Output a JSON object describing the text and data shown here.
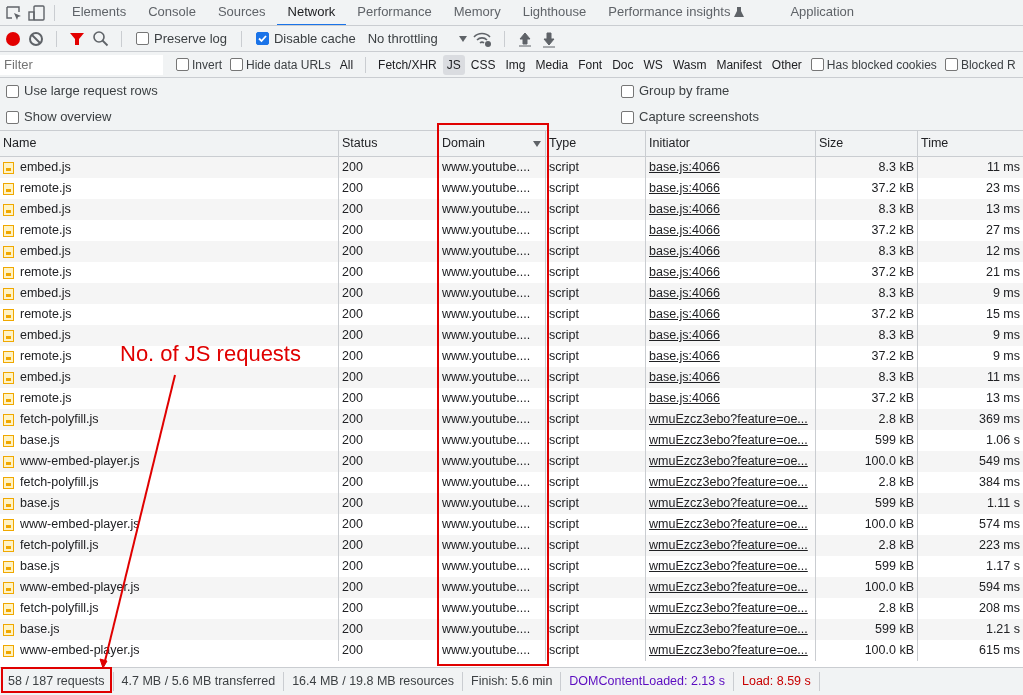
{
  "tabs": [
    {
      "label": "Elements",
      "selected": false,
      "experimental": false
    },
    {
      "label": "Console",
      "selected": false,
      "experimental": false
    },
    {
      "label": "Sources",
      "selected": false,
      "experimental": false
    },
    {
      "label": "Network",
      "selected": true,
      "experimental": false
    },
    {
      "label": "Performance",
      "selected": false,
      "experimental": false
    },
    {
      "label": "Memory",
      "selected": false,
      "experimental": false
    },
    {
      "label": "Lighthouse",
      "selected": false,
      "experimental": false
    },
    {
      "label": "Performance insights",
      "selected": false,
      "experimental": true
    },
    {
      "label": "Application",
      "selected": false,
      "experimental": false
    }
  ],
  "toolbar": {
    "recording": true,
    "filter_active": true,
    "preserve_log": {
      "label": "Preserve log",
      "checked": false
    },
    "disable_cache": {
      "label": "Disable cache",
      "checked": true
    },
    "throttling": {
      "value": "No throttling"
    }
  },
  "filter_bar": {
    "placeholder": "Filter",
    "checkboxes": [
      {
        "label": "Invert",
        "checked": false
      },
      {
        "label": "Hide data URLs",
        "checked": false
      }
    ],
    "types": [
      {
        "label": "All",
        "selected": false
      },
      {
        "label": "Fetch/XHR",
        "selected": false
      },
      {
        "label": "JS",
        "selected": true
      },
      {
        "label": "CSS",
        "selected": false
      },
      {
        "label": "Img",
        "selected": false
      },
      {
        "label": "Media",
        "selected": false
      },
      {
        "label": "Font",
        "selected": false
      },
      {
        "label": "Doc",
        "selected": false
      },
      {
        "label": "WS",
        "selected": false
      },
      {
        "label": "Wasm",
        "selected": false
      },
      {
        "label": "Manifest",
        "selected": false
      },
      {
        "label": "Other",
        "selected": false
      }
    ],
    "extra_checkboxes": [
      {
        "label": "Has blocked cookies",
        "checked": false
      },
      {
        "label": "Blocked R",
        "checked": false
      }
    ]
  },
  "options": [
    {
      "label": "Use large request rows",
      "checked": false
    },
    {
      "label": "Group by frame",
      "checked": false
    },
    {
      "label": "Show overview",
      "checked": false
    },
    {
      "label": "Capture screenshots",
      "checked": false
    }
  ],
  "table": {
    "columns": [
      {
        "label": "Name",
        "sorted": false
      },
      {
        "label": "Status",
        "sorted": false
      },
      {
        "label": "Domain",
        "sorted": true
      },
      {
        "label": "Type",
        "sorted": false
      },
      {
        "label": "Initiator",
        "sorted": false
      },
      {
        "label": "Size",
        "sorted": false
      },
      {
        "label": "Time",
        "sorted": false
      }
    ],
    "rows": [
      [
        "embed.js",
        "200",
        "www.youtube....",
        "script",
        "base.js:4066",
        "8.3 kB",
        "11 ms"
      ],
      [
        "remote.js",
        "200",
        "www.youtube....",
        "script",
        "base.js:4066",
        "37.2 kB",
        "23 ms"
      ],
      [
        "embed.js",
        "200",
        "www.youtube....",
        "script",
        "base.js:4066",
        "8.3 kB",
        "13 ms"
      ],
      [
        "remote.js",
        "200",
        "www.youtube....",
        "script",
        "base.js:4066",
        "37.2 kB",
        "27 ms"
      ],
      [
        "embed.js",
        "200",
        "www.youtube....",
        "script",
        "base.js:4066",
        "8.3 kB",
        "12 ms"
      ],
      [
        "remote.js",
        "200",
        "www.youtube....",
        "script",
        "base.js:4066",
        "37.2 kB",
        "21 ms"
      ],
      [
        "embed.js",
        "200",
        "www.youtube....",
        "script",
        "base.js:4066",
        "8.3 kB",
        "9 ms"
      ],
      [
        "remote.js",
        "200",
        "www.youtube....",
        "script",
        "base.js:4066",
        "37.2 kB",
        "15 ms"
      ],
      [
        "embed.js",
        "200",
        "www.youtube....",
        "script",
        "base.js:4066",
        "8.3 kB",
        "9 ms"
      ],
      [
        "remote.js",
        "200",
        "www.youtube....",
        "script",
        "base.js:4066",
        "37.2 kB",
        "9 ms"
      ],
      [
        "embed.js",
        "200",
        "www.youtube....",
        "script",
        "base.js:4066",
        "8.3 kB",
        "11 ms"
      ],
      [
        "remote.js",
        "200",
        "www.youtube....",
        "script",
        "base.js:4066",
        "37.2 kB",
        "13 ms"
      ],
      [
        "fetch-polyfill.js",
        "200",
        "www.youtube....",
        "script",
        "wmuEzcz3ebo?feature=oe...",
        "2.8 kB",
        "369 ms"
      ],
      [
        "base.js",
        "200",
        "www.youtube....",
        "script",
        "wmuEzcz3ebo?feature=oe...",
        "599 kB",
        "1.06 s"
      ],
      [
        "www-embed-player.js",
        "200",
        "www.youtube....",
        "script",
        "wmuEzcz3ebo?feature=oe...",
        "100.0 kB",
        "549 ms"
      ],
      [
        "fetch-polyfill.js",
        "200",
        "www.youtube....",
        "script",
        "wmuEzcz3ebo?feature=oe...",
        "2.8 kB",
        "384 ms"
      ],
      [
        "base.js",
        "200",
        "www.youtube....",
        "script",
        "wmuEzcz3ebo?feature=oe...",
        "599 kB",
        "1.11 s"
      ],
      [
        "www-embed-player.js",
        "200",
        "www.youtube....",
        "script",
        "wmuEzcz3ebo?feature=oe...",
        "100.0 kB",
        "574 ms"
      ],
      [
        "fetch-polyfill.js",
        "200",
        "www.youtube....",
        "script",
        "wmuEzcz3ebo?feature=oe...",
        "2.8 kB",
        "223 ms"
      ],
      [
        "base.js",
        "200",
        "www.youtube....",
        "script",
        "wmuEzcz3ebo?feature=oe...",
        "599 kB",
        "1.17 s"
      ],
      [
        "www-embed-player.js",
        "200",
        "www.youtube....",
        "script",
        "wmuEzcz3ebo?feature=oe...",
        "100.0 kB",
        "594 ms"
      ],
      [
        "fetch-polyfill.js",
        "200",
        "www.youtube....",
        "script",
        "wmuEzcz3ebo?feature=oe...",
        "2.8 kB",
        "208 ms"
      ],
      [
        "base.js",
        "200",
        "www.youtube....",
        "script",
        "wmuEzcz3ebo?feature=oe...",
        "599 kB",
        "1.21 s"
      ],
      [
        "www-embed-player.js",
        "200",
        "www.youtube....",
        "script",
        "wmuEzcz3ebo?feature=oe...",
        "100.0 kB",
        "615 ms"
      ]
    ]
  },
  "status_bar": [
    {
      "text": "58 / 187 requests",
      "kind": "plain"
    },
    {
      "text": "4.7 MB / 5.6 MB transferred",
      "kind": "plain"
    },
    {
      "text": "16.4 MB / 19.8 MB resources",
      "kind": "plain"
    },
    {
      "text": "Finish: 5.6 min",
      "kind": "plain"
    },
    {
      "text": "DOMContentLoaded: 2.13 s",
      "kind": "dcl"
    },
    {
      "text": "Load: 8.59 s",
      "kind": "load"
    }
  ],
  "annotation": {
    "text": "No. of JS requests"
  }
}
